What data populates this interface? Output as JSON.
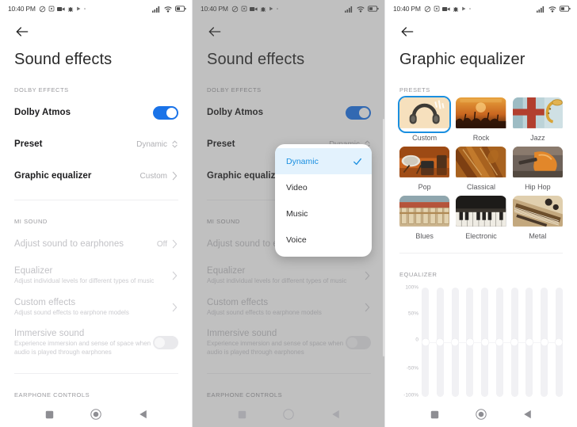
{
  "statusbar": {
    "time": "10:40 PM",
    "left_icons": [
      "do-not-disturb-icon",
      "screenshot-icon",
      "video-camera-icon",
      "bug-icon",
      "play-icon",
      "dot-icon"
    ],
    "right_icons": [
      "signal-bars-icon",
      "wifi-icon",
      "battery-icon"
    ]
  },
  "panel1": {
    "back_icon": "back-arrow-icon",
    "title": "Sound effects",
    "sections": [
      {
        "label": "DOLBY EFFECTS",
        "rows": [
          {
            "title": "Dolby Atmos",
            "sub": "",
            "value": "",
            "control": "toggle-on",
            "dim": false
          },
          {
            "title": "Preset",
            "sub": "",
            "value": "Dynamic",
            "control": "stepper-chevron",
            "dim": false
          },
          {
            "title": "Graphic equalizer",
            "sub": "",
            "value": "Custom",
            "control": "chevron",
            "dim": false
          }
        ]
      },
      {
        "label": "MI SOUND",
        "rows": [
          {
            "title": "Adjust sound to earphones",
            "sub": "",
            "value": "Off",
            "control": "chevron",
            "dim": true
          },
          {
            "title": "Equalizer",
            "sub": "Adjust individual levels for different types of music",
            "value": "",
            "control": "chevron",
            "dim": true
          },
          {
            "title": "Custom effects",
            "sub": "Adjust sound effects to earphone models",
            "value": "",
            "control": "chevron",
            "dim": true
          },
          {
            "title": "Immersive sound",
            "sub": "Experience immersion and sense of space when audio is played through earphones",
            "value": "",
            "control": "toggle-off",
            "dim": true
          }
        ]
      },
      {
        "label": "EARPHONE CONTROLS",
        "rows": []
      }
    ]
  },
  "panel2": {
    "back_icon": "back-arrow-icon",
    "title": "Sound effects",
    "dropdown": {
      "name": "preset-dropdown",
      "options": [
        {
          "label": "Dynamic",
          "selected": true
        },
        {
          "label": "Video",
          "selected": false
        },
        {
          "label": "Music",
          "selected": false
        },
        {
          "label": "Voice",
          "selected": false
        }
      ],
      "check_icon": "check-icon"
    }
  },
  "panel3": {
    "back_icon": "back-arrow-icon",
    "title": "Graphic equalizer",
    "presets_label": "PRESETS",
    "presets": [
      {
        "name": "Custom",
        "selected": true,
        "art": "headphones"
      },
      {
        "name": "Rock",
        "selected": false,
        "art": "concert"
      },
      {
        "name": "Jazz",
        "selected": false,
        "art": "saxophone"
      },
      {
        "name": "Pop",
        "selected": false,
        "art": "drums"
      },
      {
        "name": "Classical",
        "selected": false,
        "art": "violin"
      },
      {
        "name": "Hip Hop",
        "selected": false,
        "art": "guitar-orange"
      },
      {
        "name": "Blues",
        "selected": false,
        "art": "xylophone"
      },
      {
        "name": "Electronic",
        "selected": false,
        "art": "piano"
      },
      {
        "name": "Metal",
        "selected": false,
        "art": "electric-guitar"
      }
    ],
    "equalizer_label": "EQUALIZER",
    "axis_ticks": [
      "100%",
      "50%",
      "0",
      "-50%",
      "-100%"
    ],
    "band_count": 10,
    "band_values": [
      0,
      0,
      0,
      0,
      0,
      0,
      0,
      0,
      0,
      0
    ]
  },
  "navbar": {
    "items": [
      {
        "icon": "recents-square-icon"
      },
      {
        "icon": "home-circle-icon"
      },
      {
        "icon": "back-triangle-icon"
      }
    ]
  },
  "colors": {
    "accent": "#1a73e8",
    "dropdown_accent": "#1a8fe0",
    "selected_bg": "#e3f2fd",
    "scrim": "rgba(90,90,90,0.38)"
  }
}
